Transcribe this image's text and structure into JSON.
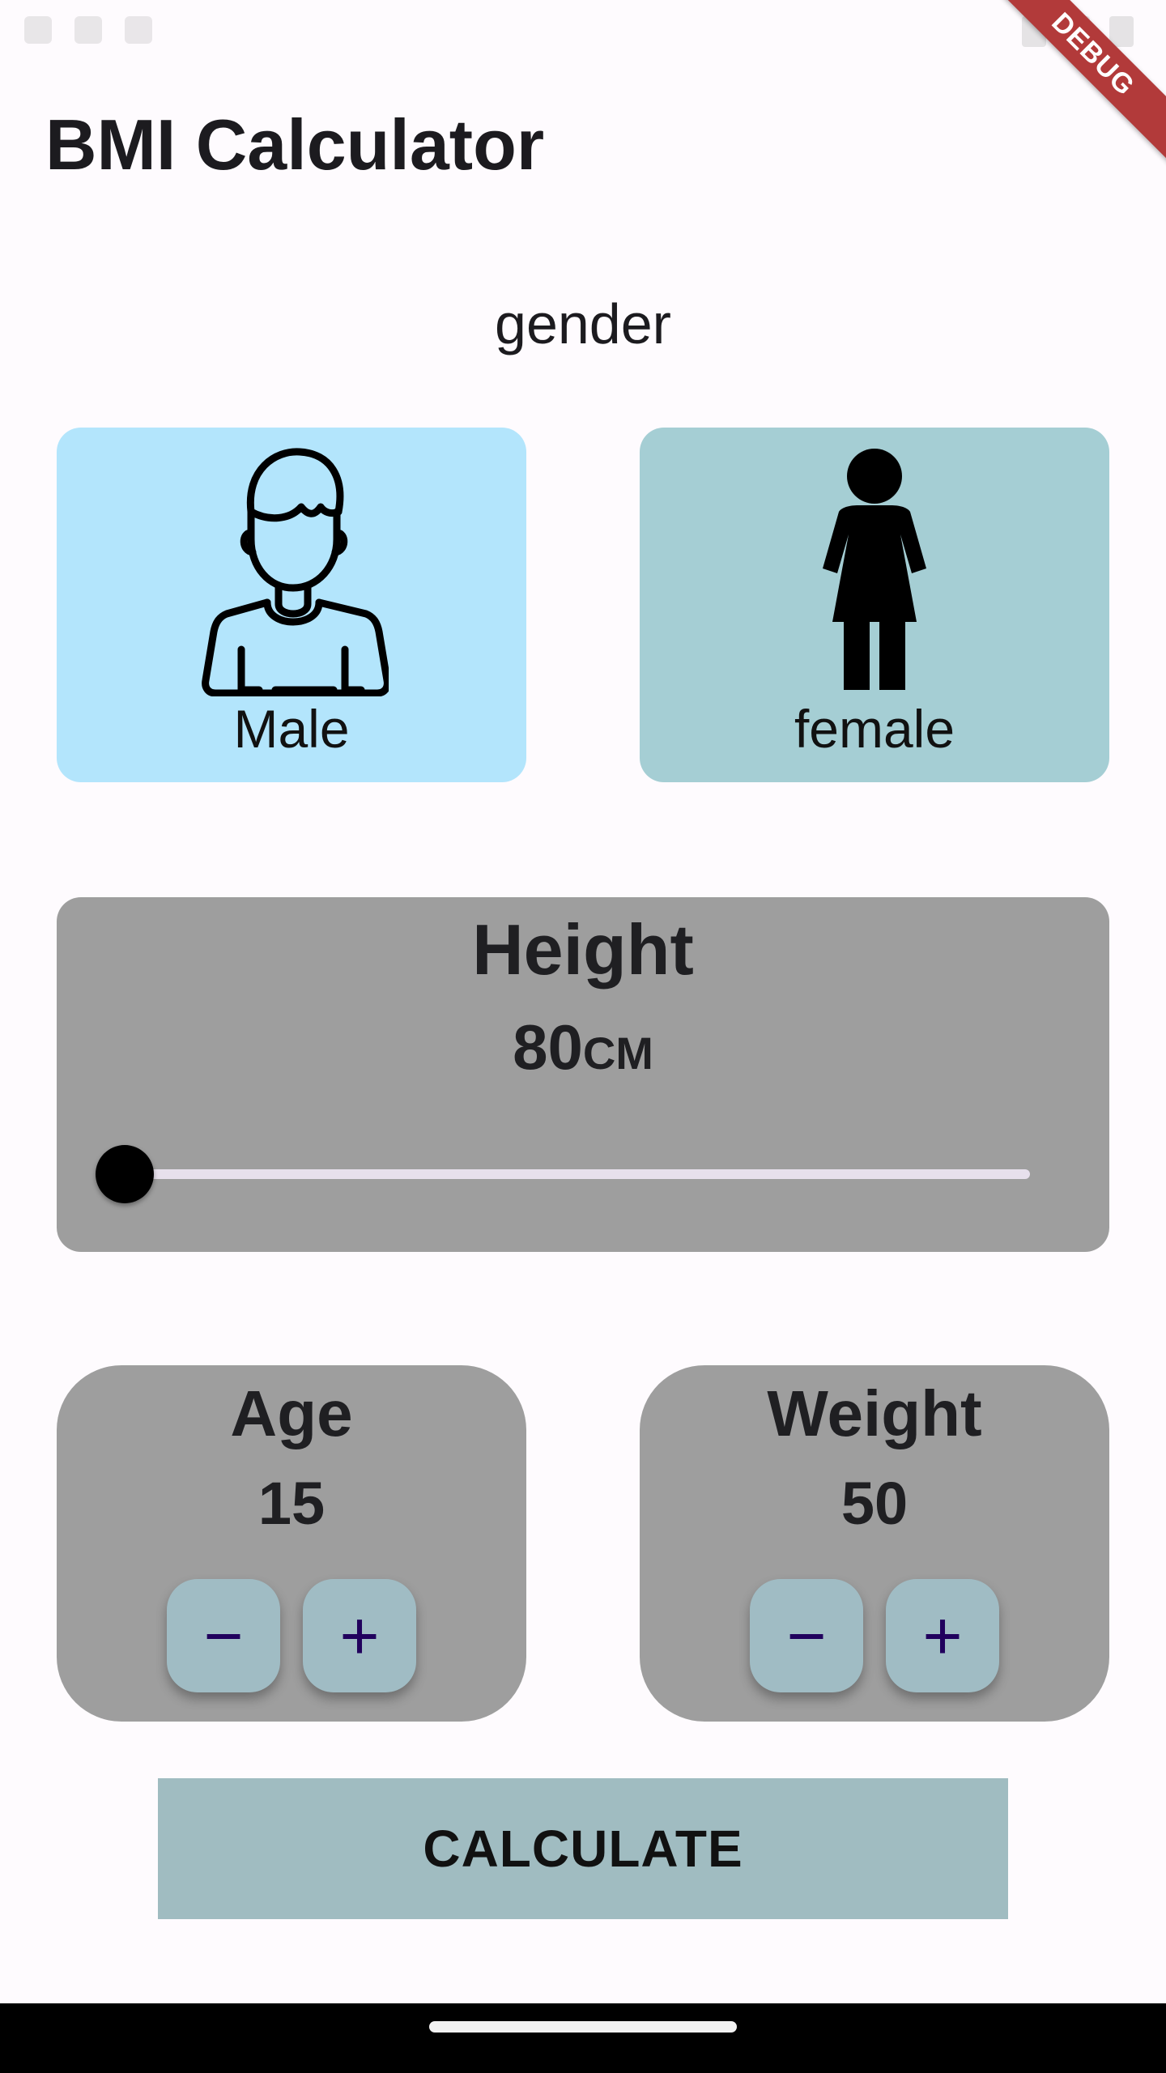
{
  "debug_banner": "DEBUG",
  "app_title": "BMI Calculator",
  "gender": {
    "label": "gender",
    "male": {
      "label": "Male",
      "icon": "male-person-outline-icon",
      "color": "#b3e5fc"
    },
    "female": {
      "label": "female",
      "icon": "female-person-icon",
      "color": "#a5ced4"
    }
  },
  "height": {
    "title": "Height",
    "value": "80",
    "unit": "CM",
    "slider_fraction": 0
  },
  "age": {
    "title": "Age",
    "value": "15",
    "minus_label": "−",
    "plus_label": "+"
  },
  "weight": {
    "title": "Weight",
    "value": "50",
    "minus_label": "−",
    "plus_label": "+"
  },
  "calculate_label": "CALCULATE",
  "colors": {
    "background": "#fefbfe",
    "card_gray": "#9e9e9e",
    "button_fill": "#a0bcc4",
    "button_icon": "#21005d",
    "debug_red": "#b23a3a"
  }
}
